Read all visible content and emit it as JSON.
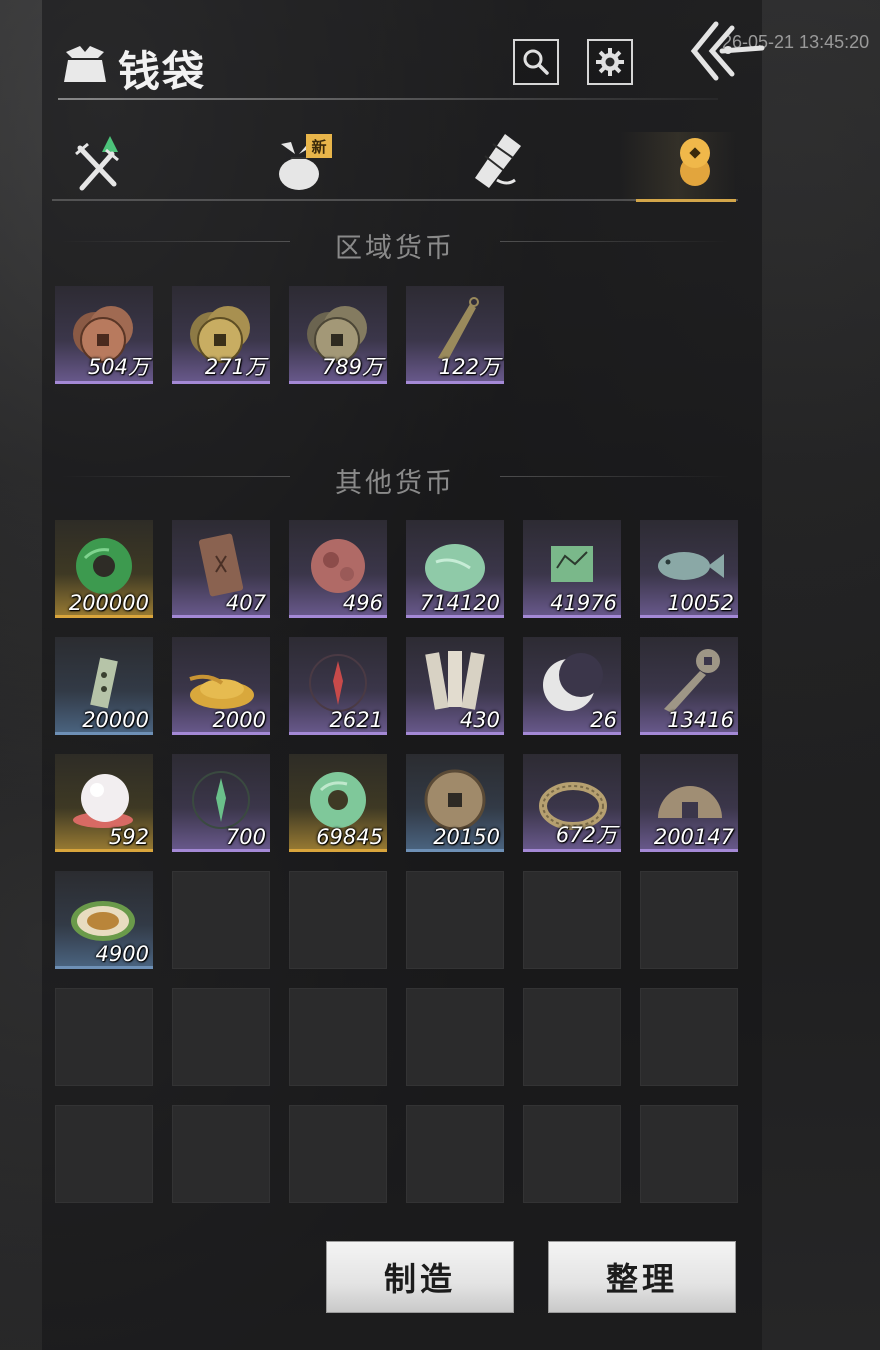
{
  "header": {
    "title": "钱袋",
    "clock": "26-05-21 13:45:20",
    "icons": {
      "bag": "money-bag-icon",
      "search": "search-icon",
      "settings": "gear-icon",
      "back": "double-chevron-left-icon"
    }
  },
  "tabs": [
    {
      "name": "weapons",
      "icon": "crossed-swords-icon",
      "active": false,
      "badge": ""
    },
    {
      "name": "bundle",
      "icon": "cloth-bundle-icon",
      "active": false,
      "badge": "新"
    },
    {
      "name": "scroll",
      "icon": "scroll-icon",
      "active": false,
      "badge": ""
    },
    {
      "name": "currency",
      "icon": "coin-stack-icon",
      "active": true,
      "badge": ""
    }
  ],
  "sections": {
    "regional": {
      "title": "区域货币"
    },
    "other": {
      "title": "其他货币"
    }
  },
  "regional_items": [
    {
      "icon": "copper-coins-icon",
      "qty": "504万",
      "rarity": "purple"
    },
    {
      "icon": "brass-coins-icon",
      "qty": "271万",
      "rarity": "purple"
    },
    {
      "icon": "bronze-coins-icon",
      "qty": "789万",
      "rarity": "purple"
    },
    {
      "icon": "knife-coin-icon",
      "qty": "122万",
      "rarity": "purple"
    }
  ],
  "other_items": [
    {
      "icon": "green-jade-disc-icon",
      "qty": "200000",
      "rarity": "gold"
    },
    {
      "icon": "bronze-token-icon",
      "qty": "407",
      "rarity": "purple"
    },
    {
      "icon": "red-stone-icon",
      "qty": "496",
      "rarity": "purple"
    },
    {
      "icon": "jade-pebble-icon",
      "qty": "714120",
      "rarity": "purple"
    },
    {
      "icon": "jade-map-icon",
      "qty": "41976",
      "rarity": "purple"
    },
    {
      "icon": "jade-fish-icon",
      "qty": "10052",
      "rarity": "purple"
    },
    {
      "icon": "jade-tablet-icon",
      "qty": "20000",
      "rarity": "blue"
    },
    {
      "icon": "grain-pile-icon",
      "qty": "2000",
      "rarity": "purple"
    },
    {
      "icon": "red-sigil-icon",
      "qty": "2621",
      "rarity": "purple"
    },
    {
      "icon": "bamboo-slips-icon",
      "qty": "430",
      "rarity": "purple"
    },
    {
      "icon": "crescent-moon-icon",
      "qty": "26",
      "rarity": "purple"
    },
    {
      "icon": "coin-key-icon",
      "qty": "13416",
      "rarity": "purple"
    },
    {
      "icon": "pearl-icon",
      "qty": "592",
      "rarity": "gold"
    },
    {
      "icon": "green-sigil-icon",
      "qty": "700",
      "rarity": "purple"
    },
    {
      "icon": "pale-jade-disc-icon",
      "qty": "69845",
      "rarity": "gold"
    },
    {
      "icon": "square-hole-coin-icon",
      "qty": "20150",
      "rarity": "blue"
    },
    {
      "icon": "coin-string-icon",
      "qty": "672万",
      "rarity": "purple"
    },
    {
      "icon": "half-coin-icon",
      "qty": "200147",
      "rarity": "purple"
    },
    {
      "icon": "melon-slice-icon",
      "qty": "4900",
      "rarity": "blue"
    }
  ],
  "buttons": {
    "craft": "制造",
    "sort": "整理"
  }
}
